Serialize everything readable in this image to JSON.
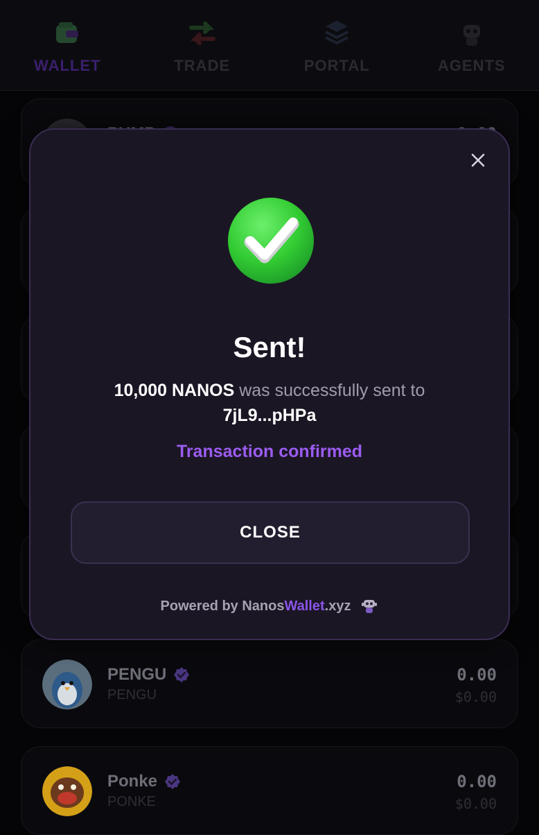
{
  "nav": {
    "items": [
      {
        "label": "WALLET",
        "icon": "wallet-icon",
        "active": true
      },
      {
        "label": "TRADE",
        "icon": "trade-arrows-icon",
        "active": false
      },
      {
        "label": "PORTAL",
        "icon": "layers-icon",
        "active": false
      },
      {
        "label": "AGENTS",
        "icon": "robot-icon",
        "active": false
      }
    ]
  },
  "tokens": [
    {
      "name": "PUMP",
      "symbol": "",
      "amount": "0.00",
      "value": ""
    },
    {
      "name": "PENGU",
      "symbol": "PENGU",
      "amount": "0.00",
      "value": "$0.00"
    },
    {
      "name": "Ponke",
      "symbol": "PONKE",
      "amount": "0.00",
      "value": "$0.00"
    }
  ],
  "modal": {
    "title": "Sent!",
    "amount_text": "10,000 NANOS",
    "message_middle": " was successfully sent to",
    "recipient": "7jL9...pHPa",
    "status": "Transaction confirmed",
    "close_button": "CLOSE",
    "powered_prefix": "Powered by Nanos",
    "powered_accent": "Wallet",
    "powered_suffix": ".xyz"
  },
  "colors": {
    "accent": "#9b5cf0",
    "success": "#3ccc3c",
    "modal_bg": "#1b1624"
  }
}
